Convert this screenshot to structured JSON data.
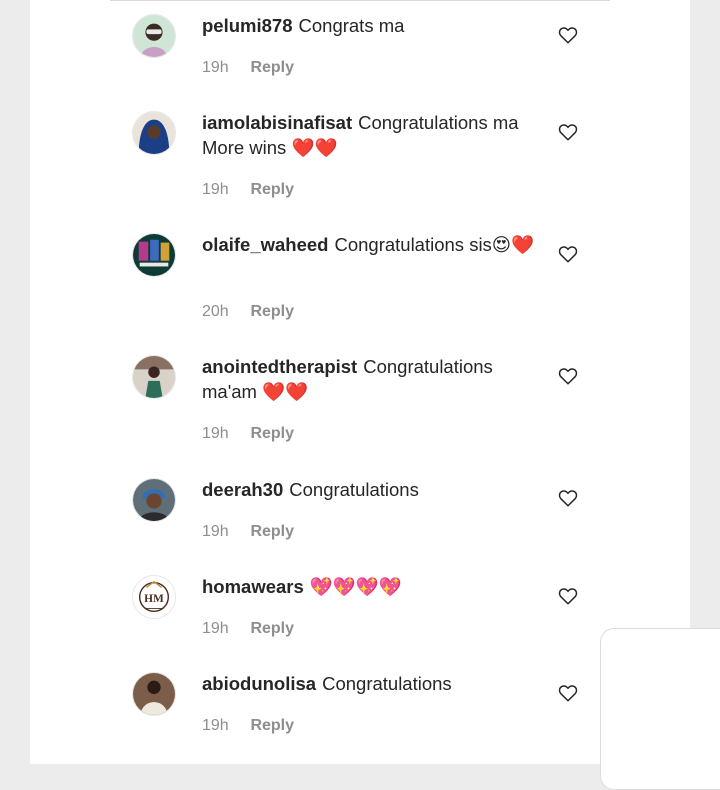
{
  "comments": [
    {
      "username": "pelumi878",
      "text": "Congrats ma",
      "time": "19h",
      "reply": "Reply",
      "avatar_icon": "avatar-photo"
    },
    {
      "username": "iamolabisinafisat",
      "text": "Congratulations ma More wins ❤️❤️",
      "time": "19h",
      "reply": "Reply",
      "avatar_icon": "avatar-photo"
    },
    {
      "username": "olaife_waheed",
      "text": "Congratulations sis😍❤️",
      "time": "20h",
      "reply": "Reply",
      "avatar_icon": "avatar-photo"
    },
    {
      "username": "anointedtherapist",
      "text": "Congratulations ma'am ❤️❤️",
      "time": "19h",
      "reply": "Reply",
      "avatar_icon": "avatar-photo"
    },
    {
      "username": "deerah30",
      "text": "Congratulations",
      "time": "19h",
      "reply": "Reply",
      "avatar_icon": "avatar-photo"
    },
    {
      "username": "homawears",
      "text": "💖💖💖💖",
      "time": "19h",
      "reply": "Reply",
      "avatar_icon": "avatar-logo"
    },
    {
      "username": "abiodunolisa",
      "text": "Congratulations",
      "time": "19h",
      "reply": "Reply",
      "avatar_icon": "avatar-photo"
    }
  ],
  "avatar_logo_text": "HM",
  "like_icon": "heart-outline-icon",
  "colors": {
    "text": "#262626",
    "meta": "#8e8e8e",
    "background": "#ffffff",
    "page": "#ececec"
  }
}
